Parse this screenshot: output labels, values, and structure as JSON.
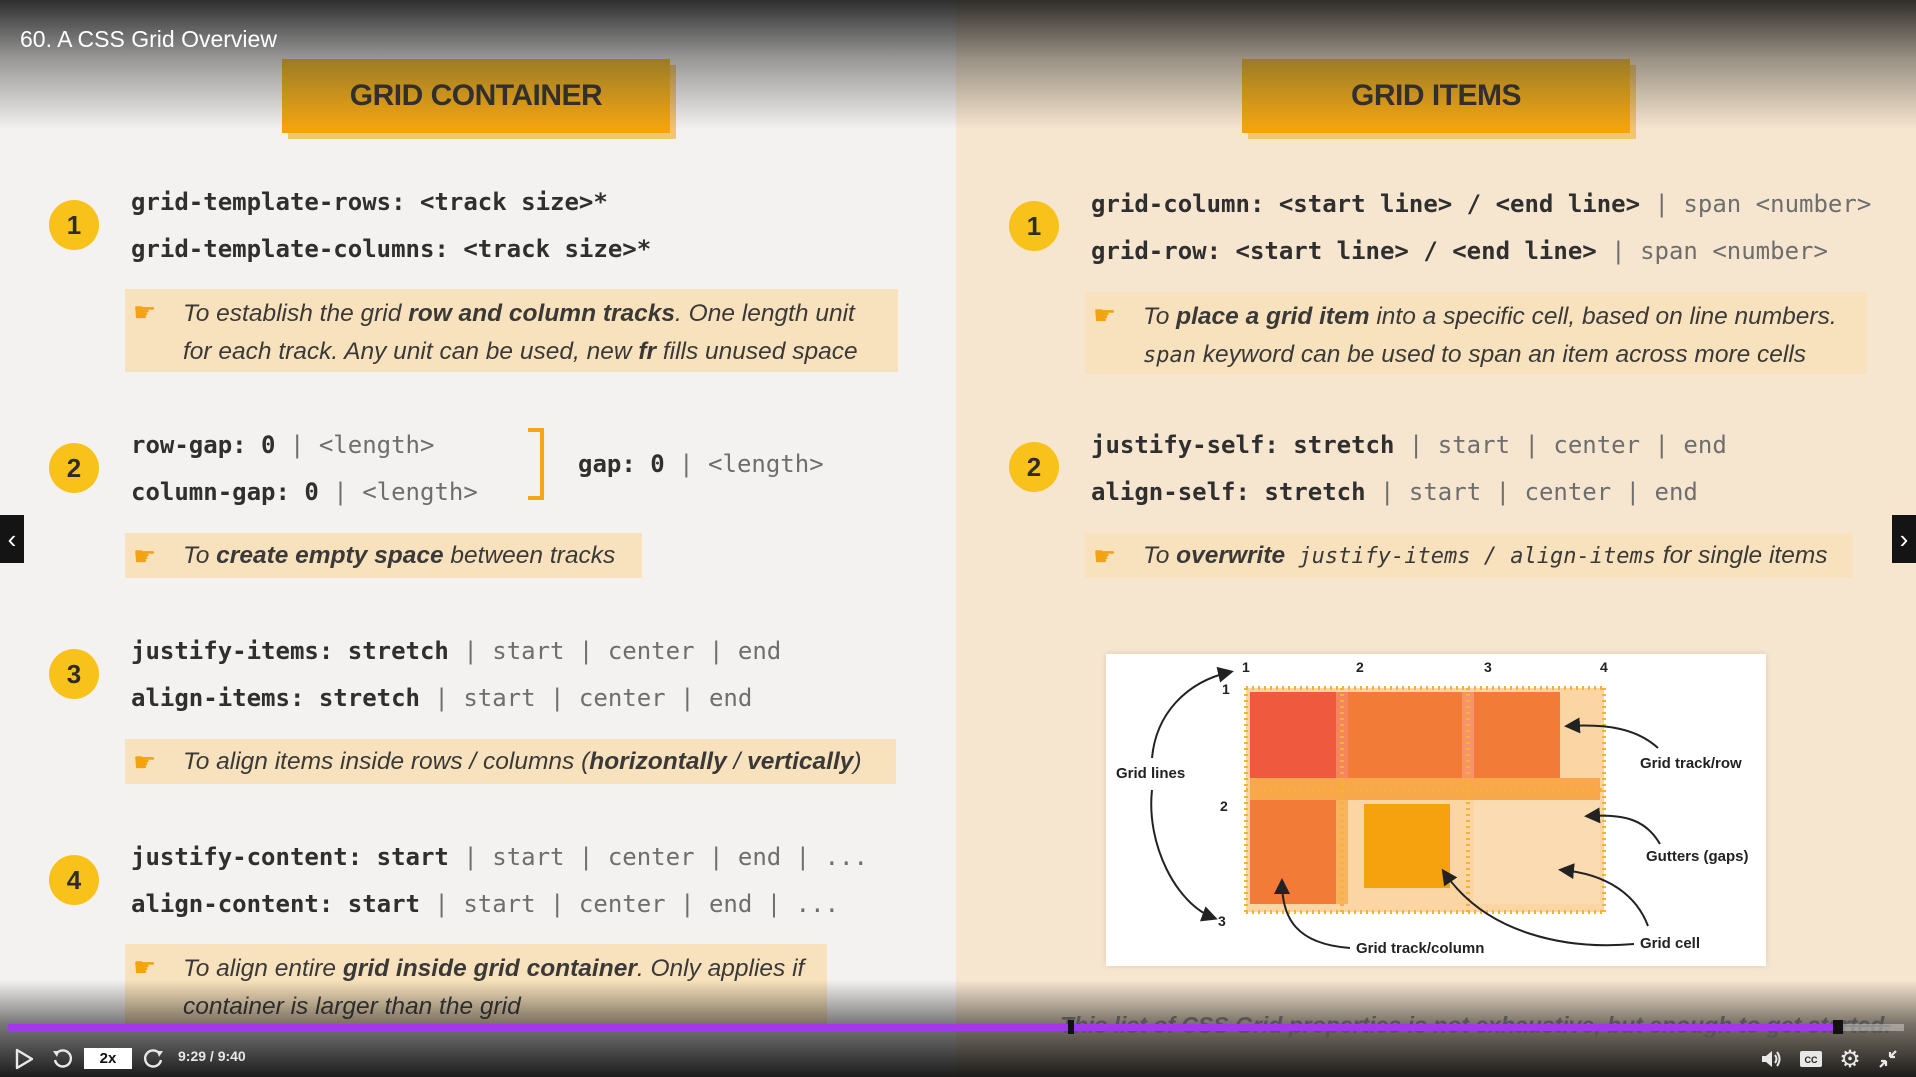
{
  "video": {
    "title": "60. A CSS Grid Overview"
  },
  "left": {
    "banner": "GRID CONTAINER",
    "items": [
      {
        "num": "1",
        "lines": [
          {
            "prop": "grid-template-rows: <track size>*"
          },
          {
            "prop": "grid-template-columns: <track size>*"
          }
        ],
        "note": {
          "l1a": "To establish the grid ",
          "l1b": "row and column tracks",
          "l1c": ". One length unit",
          "l2a": "for each track. Any unit can be used, new ",
          "l2b": "fr",
          "l2c": " fills unused space"
        }
      },
      {
        "num": "2",
        "row_gap": {
          "prop": "row-gap: 0",
          "rest": " | <length>"
        },
        "column_gap": {
          "prop": "column-gap: 0",
          "rest": " | <length>"
        },
        "gap": {
          "prop": "gap: 0",
          "rest": " | <length>"
        },
        "note": {
          "a": "To ",
          "b": "create empty space",
          "c": " between tracks"
        }
      },
      {
        "num": "3",
        "l1": {
          "prop": "justify-items: stretch",
          "rest": " | start | center | end"
        },
        "l2": {
          "prop": "align-items: stretch",
          "rest": " | start | center | end"
        },
        "note": {
          "a": "To align items inside rows / columns (",
          "b": "horizontally",
          "c": " / ",
          "d": "vertically",
          "e": ")"
        }
      },
      {
        "num": "4",
        "l1": {
          "prop": "justify-content: start",
          "rest": " | start | center | end | ..."
        },
        "l2": {
          "prop": "align-content: start",
          "rest": " | start | center | end | ..."
        },
        "note": {
          "l1a": "To align entire ",
          "l1b": "grid inside grid container",
          "l1c": ". Only applies if",
          "l2": "container is larger than the grid"
        }
      }
    ]
  },
  "right": {
    "banner": "GRID ITEMS",
    "items": [
      {
        "num": "1",
        "l1": {
          "prop": "grid-column: <start line> / <end line>",
          "rest": " | span <number>"
        },
        "l2": {
          "prop": "grid-row: <start line> / <end line>",
          "rest": " | span <number>"
        },
        "note": {
          "l1a": "To ",
          "l1b": "place a grid item",
          "l1c": " into a specific cell, based on line numbers.",
          "l2a": "span",
          "l2b": " keyword can be used to span an item across more cells"
        }
      },
      {
        "num": "2",
        "l1": {
          "prop": "justify-self: stretch",
          "rest": " | start | center | end"
        },
        "l2": {
          "prop": "align-self: stretch",
          "rest": " | start | center | end"
        },
        "note": {
          "a": "To ",
          "b": "overwrite",
          "c": " justify-items / align-items",
          "d": " for single items"
        }
      }
    ],
    "diagram": {
      "col_numbers": [
        "1",
        "2",
        "3",
        "4"
      ],
      "row_numbers": [
        "1",
        "2",
        "3"
      ],
      "labels": {
        "grid_lines": "Grid lines",
        "track_row": "Grid track/row",
        "gutters": "Gutters (gaps)",
        "track_column": "Grid track/column",
        "cell": "Grid cell"
      }
    },
    "footnote": "This list of CSS Grid properties is not exhaustive, but enough to get started."
  },
  "player": {
    "speed": "2x",
    "time": "9:29 / 9:40",
    "progress": 0.965,
    "icons": [
      "play-icon",
      "rewind-icon",
      "forward-icon",
      "volume-icon",
      "captions-icon",
      "settings-icon",
      "exit-fullscreen-icon"
    ]
  },
  "colors": {
    "accent": "#f8c21b",
    "banner": "#f6a20e",
    "progress": "#a435f0",
    "note_bg": "#f8e2bd"
  }
}
